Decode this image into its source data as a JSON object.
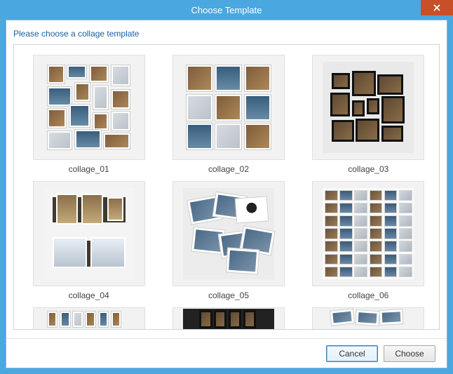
{
  "window": {
    "title": "Choose Template"
  },
  "instruction": "Please choose a collage template",
  "templates": [
    {
      "label": "collage_01"
    },
    {
      "label": "collage_02"
    },
    {
      "label": "collage_03"
    },
    {
      "label": "collage_04"
    },
    {
      "label": "collage_05"
    },
    {
      "label": "collage_06"
    }
  ],
  "buttons": {
    "cancel": "Cancel",
    "choose": "Choose"
  }
}
